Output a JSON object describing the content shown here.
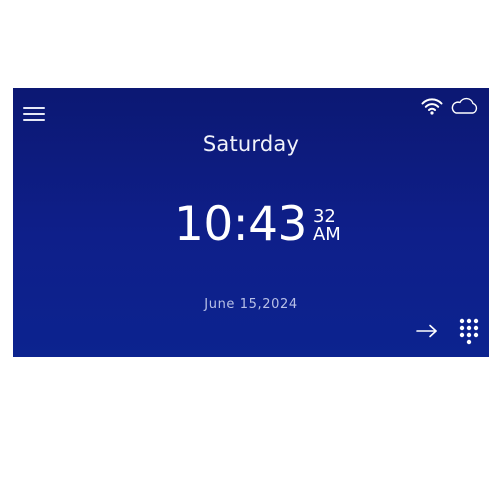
{
  "header": {
    "menu_icon": "hamburger-menu-icon",
    "status_icons": [
      "wifi-icon",
      "cloud-icon"
    ]
  },
  "main": {
    "day": "Saturday",
    "time": {
      "hours_minutes": "10:43",
      "seconds": "32",
      "meridiem": "AM"
    },
    "date": "June 15,2024"
  },
  "footer": {
    "arrow_icon": "arrow-right-icon",
    "keypad_icon": "keypad-icon"
  },
  "colors": {
    "background": "#0e1f8a",
    "text": "#ffffff",
    "date_text": "#b8c0e6"
  }
}
